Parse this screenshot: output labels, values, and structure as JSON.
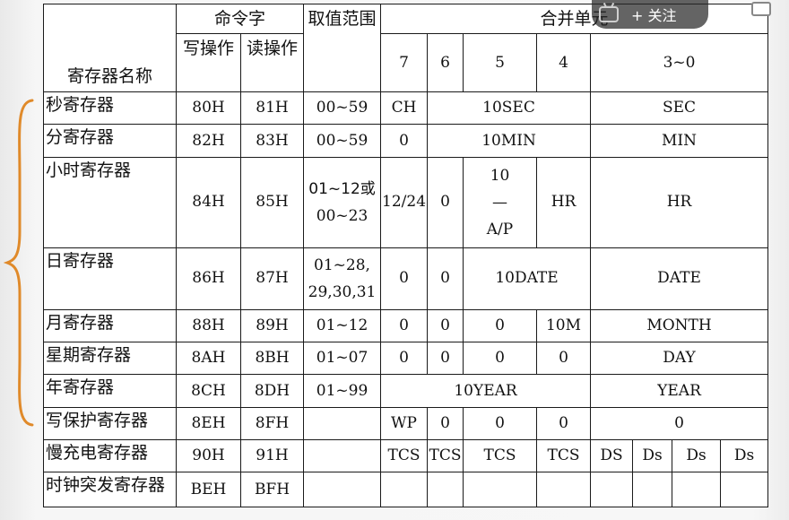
{
  "headers": {
    "reg_name": "寄存器名称",
    "command_word": "命令字",
    "write_op": "写操作",
    "read_op": "读操作",
    "value_range": "取值范围",
    "merged_units": "合并单元",
    "bit7": "7",
    "bit6": "6",
    "bit5": "5",
    "bit4": "4",
    "bits3_0": "3~0"
  },
  "rows": [
    {
      "name": "秒寄存器",
      "write": "80H",
      "read": "81H",
      "range": "00~59",
      "c7": "CH",
      "c65_4": "10SEC",
      "c30": "SEC"
    },
    {
      "name": "分寄存器",
      "write": "82H",
      "read": "83H",
      "range": "00~59",
      "c7": "0",
      "c65_4": "10MIN",
      "c30": "MIN"
    },
    {
      "name": "小时寄存器",
      "write": "84H",
      "read": "85H",
      "range_a": "01~12或",
      "range_b": "00~23",
      "c7": "12/24",
      "c6": "0",
      "c5_a": "10",
      "c5_b": "—",
      "c5_c": "A/P",
      "c4": "HR",
      "c30": "HR"
    },
    {
      "name": "日寄存器",
      "write": "86H",
      "read": "87H",
      "range_a": "01~28,",
      "range_b": "29,30,31",
      "c7": "0",
      "c6": "0",
      "c54": "10DATE",
      "c30": "DATE"
    },
    {
      "name": "月寄存器",
      "write": "88H",
      "read": "89H",
      "range": "01~12",
      "c7": "0",
      "c6": "0",
      "c5": "0",
      "c4": "10M",
      "c30": "MONTH"
    },
    {
      "name": "星期寄存器",
      "write": "8AH",
      "read": "8BH",
      "range": "01~07",
      "c7": "0",
      "c6": "0",
      "c5": "0",
      "c4": "0",
      "c30": "DAY"
    },
    {
      "name": "年寄存器",
      "write": "8CH",
      "read": "8DH",
      "range": "01~99",
      "c74": "10YEAR",
      "c30": "YEAR"
    },
    {
      "name": "写保护寄存器",
      "write": "8EH",
      "read": "8FH",
      "range": "",
      "c7": "WP",
      "c6": "0",
      "c5": "0",
      "c4": "0",
      "c30": "0"
    },
    {
      "name": "慢充电寄存器",
      "write": "90H",
      "read": "91H",
      "range": "",
      "c7": "TCS",
      "c6": "TCS",
      "c5": "TCS",
      "c4": "TCS",
      "d3": "DS",
      "d2": "Ds",
      "d1": "Ds",
      "d0": "Ds"
    },
    {
      "name": "时钟突发寄存器",
      "write": "BEH",
      "read": "BFH",
      "range": ""
    }
  ],
  "overlay": {
    "follow_label": "+ 关注",
    "tv_icon": "bilibili-tv-icon"
  },
  "colors": {
    "brace": "#e08a2a",
    "grid": "#1a1a1a"
  }
}
